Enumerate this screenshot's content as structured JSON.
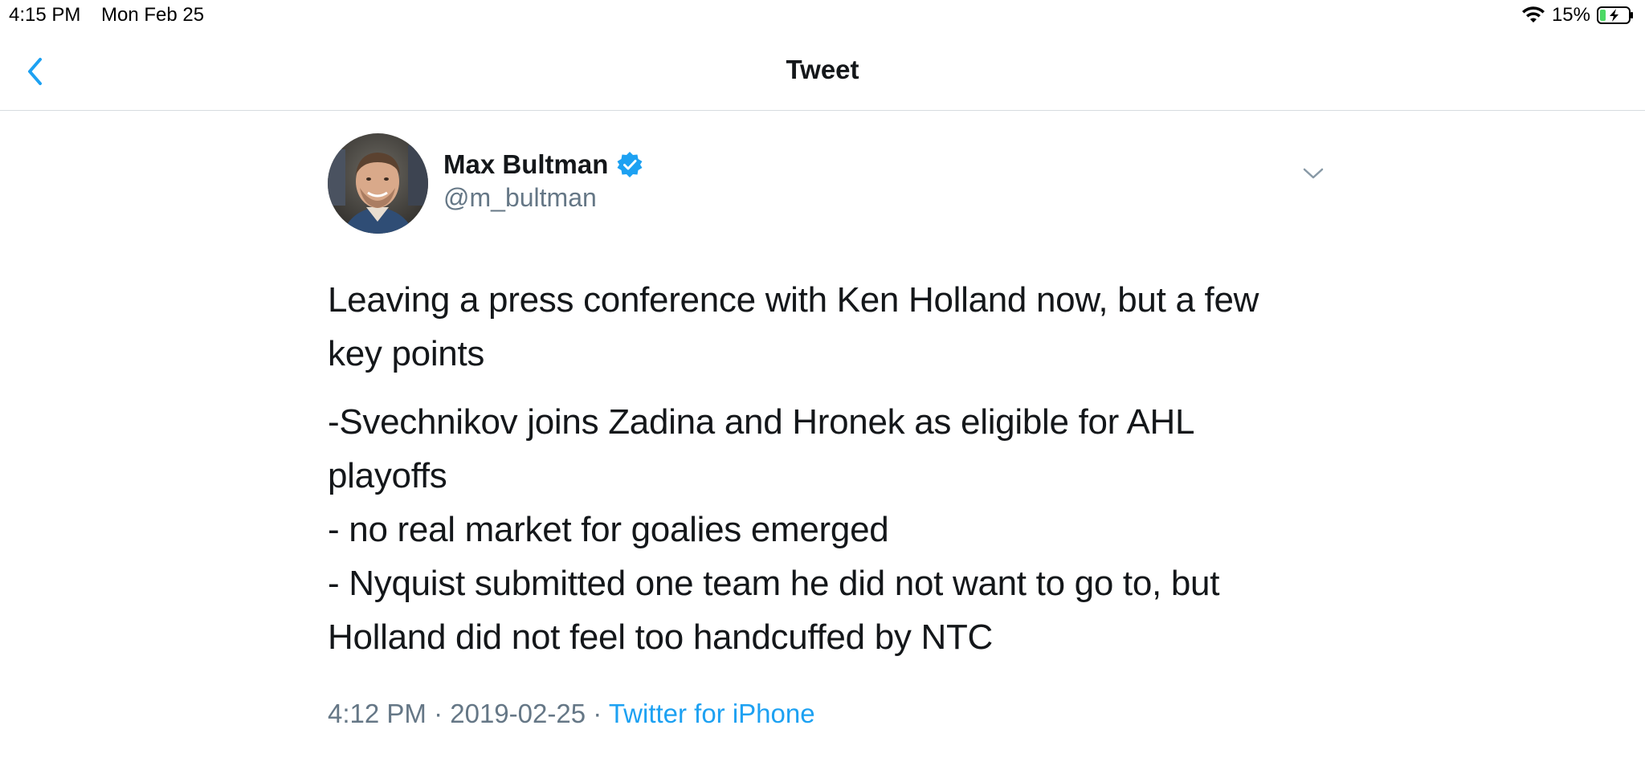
{
  "status_bar": {
    "time": "4:15 PM",
    "date": "Mon Feb 25",
    "battery_percent": "15%",
    "icons": [
      "wifi-icon",
      "battery-charging-icon"
    ]
  },
  "nav": {
    "title": "Tweet",
    "back_icon": "chevron-left-icon"
  },
  "tweet": {
    "author": {
      "name": "Max Bultman",
      "handle": "@m_bultman",
      "verified": true
    },
    "text": {
      "paragraph1": "Leaving a press conference with Ken Holland now, but a few key points",
      "line1": "-Svechnikov joins Zadina and Hronek as eligible for AHL playoffs",
      "line2": "- no real market for goalies emerged",
      "line3": "- Nyquist submitted one team he did not want to go to, but Holland did not feel too handcuffed by NTC"
    },
    "meta": {
      "time": "4:12 PM",
      "separator": "·",
      "date": "2019-02-25",
      "source": "Twitter for iPhone"
    }
  },
  "colors": {
    "accent": "#1da1f2",
    "text": "#14171a",
    "secondary": "#657786",
    "divider": "#d6dbe0"
  }
}
